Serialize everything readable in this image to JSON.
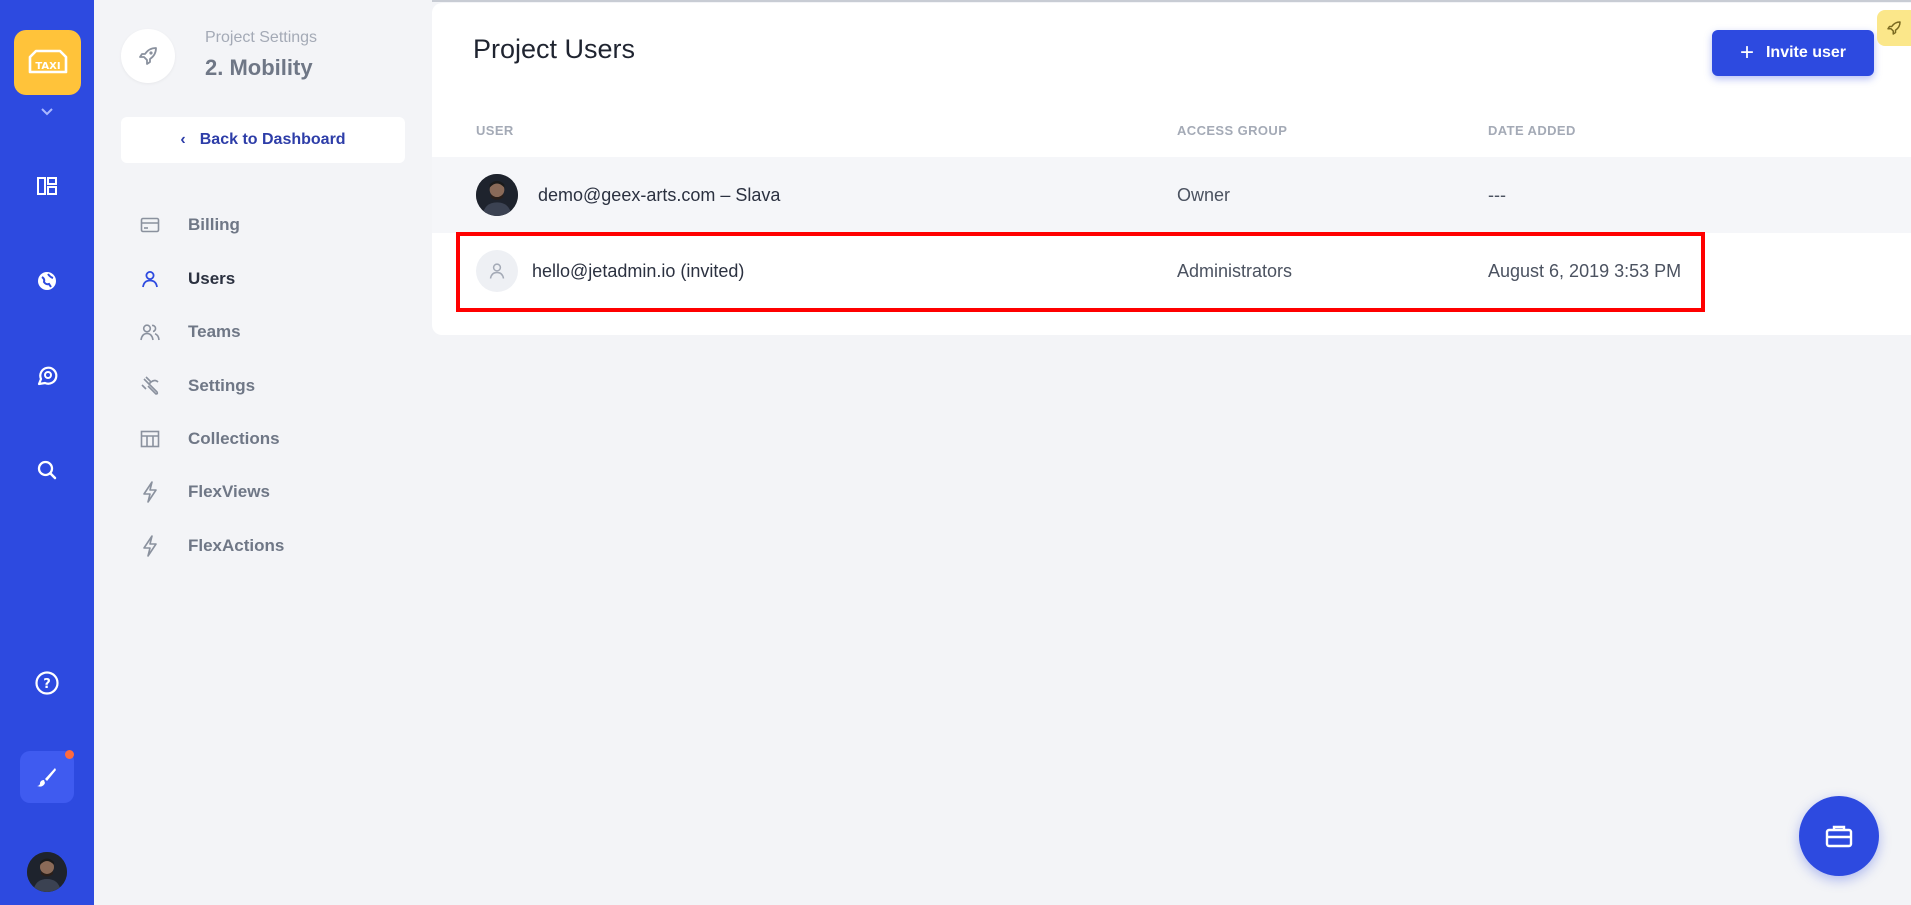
{
  "app": {
    "logo_text": "TAXI",
    "colors": {
      "rail": "#2d4ae0",
      "logo": "#ffc33a",
      "accent": "#2d4ae0",
      "highlight": "#ff0000"
    }
  },
  "rail": {
    "items": [
      {
        "icon": "dashboard-icon"
      },
      {
        "icon": "globe-icon"
      },
      {
        "icon": "chat-icon"
      },
      {
        "icon": "search-icon"
      },
      {
        "icon": "help-circle-icon"
      },
      {
        "icon": "brush-icon"
      },
      {
        "icon": "avatar"
      }
    ]
  },
  "sidebar": {
    "caption": "Project Settings",
    "project_name": "2. Mobility",
    "back_label": "Back to Dashboard",
    "items": [
      {
        "label": "Billing",
        "icon": "card-icon"
      },
      {
        "label": "Users",
        "icon": "user-icon",
        "active": true
      },
      {
        "label": "Teams",
        "icon": "team-icon"
      },
      {
        "label": "Settings",
        "icon": "wrench-icon"
      },
      {
        "label": "Collections",
        "icon": "table-icon"
      },
      {
        "label": "FlexViews",
        "icon": "lightning-icon"
      },
      {
        "label": "FlexActions",
        "icon": "lightning-icon"
      }
    ]
  },
  "main": {
    "title": "Project Users",
    "invite_label": "Invite user",
    "columns": {
      "user": "USER",
      "access_group": "ACCESS GROUP",
      "date_added": "DATE ADDED"
    },
    "rows": [
      {
        "user": "demo@geex-arts.com – Slava",
        "access_group": "Owner",
        "date_added": "---"
      },
      {
        "user": "hello@jetadmin.io (invited)",
        "access_group": "Administrators",
        "date_added": "August 6, 2019 3:53 PM"
      }
    ]
  }
}
